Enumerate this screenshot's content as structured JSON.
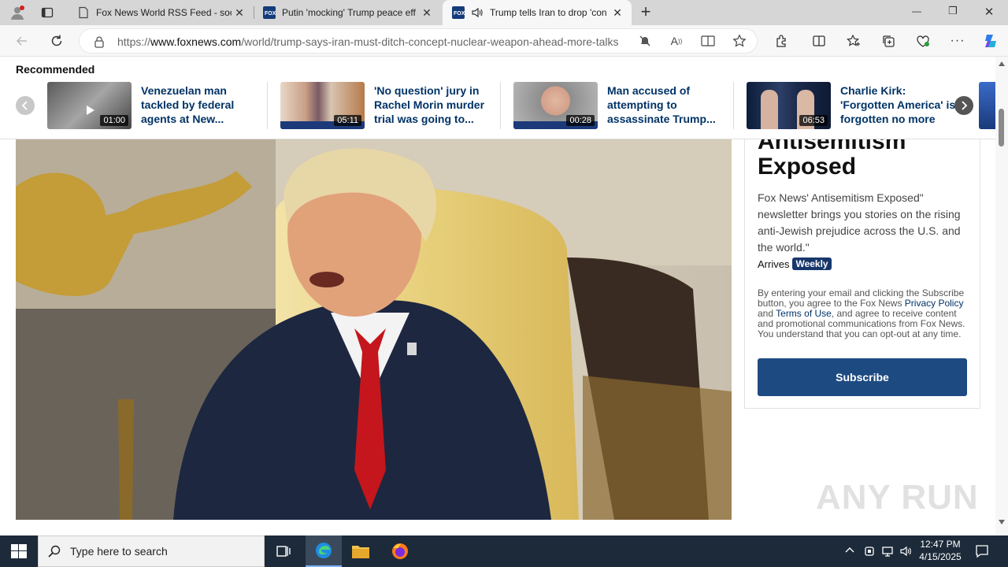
{
  "browser": {
    "tabs": [
      {
        "title": "Fox News World RSS Feed - socc",
        "active": false
      },
      {
        "title": "Putin 'mocking' Trump peace eff",
        "active": false
      },
      {
        "title": "Trump tells Iran to drop 'con",
        "active": true
      }
    ],
    "new_tab_label": "+",
    "address": {
      "scheme": "https://",
      "host": "www.foxnews.com",
      "path": "/world/trump-says-iran-must-ditch-concept-nuclear-weapon-ahead-more-talks"
    },
    "window_controls": {
      "minimize": "—",
      "restore": "❐",
      "close": "✕"
    }
  },
  "recommended": {
    "title": "Recommended",
    "items": [
      {
        "headline": "Venezuelan man tackled by federal agents at New...",
        "duration": "01:00"
      },
      {
        "headline": "'No question' jury in Rachel Morin murder trial was going to...",
        "duration": "05:11"
      },
      {
        "headline": "Man accused of attempting to assassinate Trump...",
        "duration": "00:28"
      },
      {
        "headline": "Charlie Kirk: 'Forgotten America' is forgotten no more",
        "duration": "06:53"
      }
    ]
  },
  "newsletter": {
    "title_line1": "Antisemitism",
    "title_line2": "Exposed",
    "description": "Fox News' Antisemitism Exposed\" newsletter brings you stories on the rising anti-Jewish prejudice across the U.S. and the world.\"",
    "arrives_label": "Arrives",
    "frequency": "Weekly",
    "legal_prefix": "By entering your email and clicking the Subscribe button, you agree to the Fox News ",
    "privacy_link": "Privacy Policy",
    "legal_and": " and ",
    "terms_link": "Terms of Use",
    "legal_suffix": ", and agree to receive content and promotional communications from Fox News. You understand that you can opt-out at any time.",
    "subscribe_label": "Subscribe"
  },
  "watermark": "ANY RUN",
  "taskbar": {
    "search_placeholder": "Type here to search",
    "time": "12:47 PM",
    "date": "4/15/2025"
  },
  "colors": {
    "link": "#003366",
    "subscribe": "#1e4a82",
    "badge": "#17376b",
    "taskbar": "#1c2a3a"
  }
}
